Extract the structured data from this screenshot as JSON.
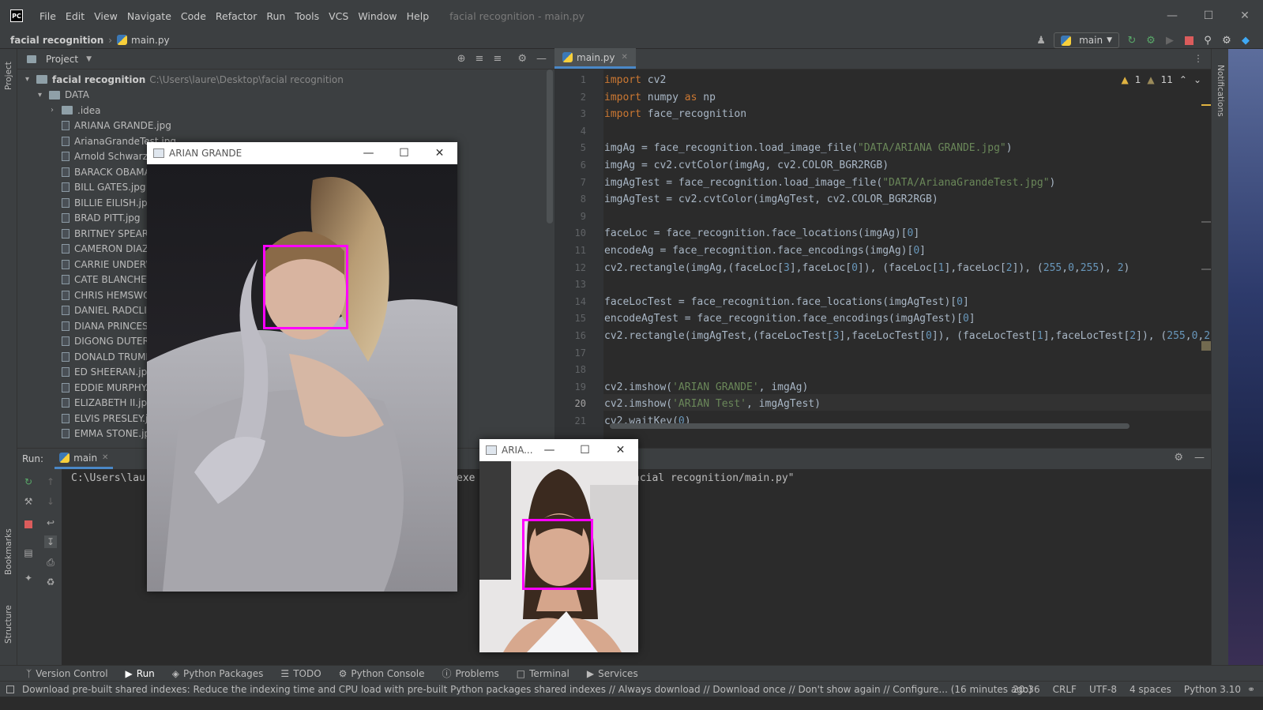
{
  "menubar": {
    "logo": "PC",
    "items": [
      "File",
      "Edit",
      "View",
      "Navigate",
      "Code",
      "Refactor",
      "Run",
      "Tools",
      "VCS",
      "Window",
      "Help"
    ],
    "window_title": "facial recognition - main.py"
  },
  "navbar": {
    "project": "facial recognition",
    "file": "main.py",
    "run_config": "main"
  },
  "left_stripe": {
    "project": "Project",
    "bookmarks": "Bookmarks",
    "structure": "Structure"
  },
  "right_stripe": {
    "notifications": "Notifications"
  },
  "project_panel": {
    "title": "Project",
    "root_name": "facial recognition",
    "root_path": "C:\\Users\\laure\\Desktop\\facial recognition",
    "data_folder": "DATA",
    "idea_folder": ".idea",
    "files": [
      "ARIANA GRANDE.jpg",
      "ArianaGrandeTest.jpg",
      "Arnold Schwarze",
      "BARACK OBAMA",
      "BILL GATES.jpg",
      "BILLIE EILISH.jpg",
      "BRAD PITT.jpg",
      "BRITNEY SPEARS",
      "CAMERON DIAZ",
      "CARRIE UNDERW",
      "CATE BLANCHET",
      "CHRIS HEMSWO",
      "DANIEL RADCLIF",
      "DIANA PRINCESS",
      "DIGONG DUTERT",
      "DONALD TRUMP",
      "ED SHEERAN.jpg",
      "EDDIE MURPHY.j",
      "ELIZABETH II.jpg",
      "ELVIS PRESLEY.jp",
      "EMMA STONE.jp"
    ]
  },
  "editor": {
    "tab": "main.py",
    "warnings": "1",
    "weak_warnings": "11",
    "current_line": 20,
    "line_numbers": [
      "1",
      "2",
      "3",
      "4",
      "5",
      "6",
      "7",
      "8",
      "9",
      "10",
      "11",
      "12",
      "13",
      "14",
      "15",
      "16",
      "17",
      "18",
      "19",
      "20",
      "21"
    ],
    "code": [
      "import cv2",
      "import numpy as np",
      "import face_recognition",
      "",
      "imgAg = face_recognition.load_image_file(\"DATA/ARIANA GRANDE.jpg\")",
      "imgAg = cv2.cvtColor(imgAg, cv2.COLOR_BGR2RGB)",
      "imgAgTest = face_recognition.load_image_file(\"DATA/ArianaGrandeTest.jpg\")",
      "imgAgTest = cv2.cvtColor(imgAgTest, cv2.COLOR_BGR2RGB)",
      "",
      "faceLoc = face_recognition.face_locations(imgAg)[0]",
      "encodeAg = face_recognition.face_encodings(imgAg)[0]",
      "cv2.rectangle(imgAg,(faceLoc[3],faceLoc[0]), (faceLoc[1],faceLoc[2]), (255,0,255), 2)",
      "",
      "faceLocTest = face_recognition.face_locations(imgAgTest)[0]",
      "encodeAgTest = face_recognition.face_encodings(imgAgTest)[0]",
      "cv2.rectangle(imgAgTest,(faceLocTest[3],faceLocTest[0]), (faceLocTest[1],faceLocTest[2]), (255,0,2",
      "",
      "",
      "cv2.imshow('ARIAN GRANDE', imgAg)",
      "cv2.imshow('ARIAN Test', imgAgTest)",
      "cv2.waitKey(0)"
    ]
  },
  "run_panel": {
    "label": "Run:",
    "tab": "main",
    "console_left": "C:\\Users\\lau",
    "console_mid": "exe",
    "console_right": "acial recognition/main.py\""
  },
  "tool_strip": {
    "items": [
      "Version Control",
      "Run",
      "Python Packages",
      "TODO",
      "Python Console",
      "Problems",
      "Terminal",
      "Services"
    ],
    "active": "Run"
  },
  "status_bar": {
    "message": "Download pre-built shared indexes: Reduce the indexing time and CPU load with pre-built Python packages shared indexes // Always download // Download once // Don't show again // Configure... (16 minutes ago)",
    "position": "20:36",
    "line_sep": "CRLF",
    "encoding": "UTF-8",
    "indent": "4 spaces",
    "interpreter": "Python 3.10"
  },
  "cv_windows": {
    "main_title": "ARIAN GRANDE",
    "test_title": "ARIA..."
  },
  "colors": {
    "face_box": "#ff00ff",
    "accent": "#4a88c7"
  }
}
